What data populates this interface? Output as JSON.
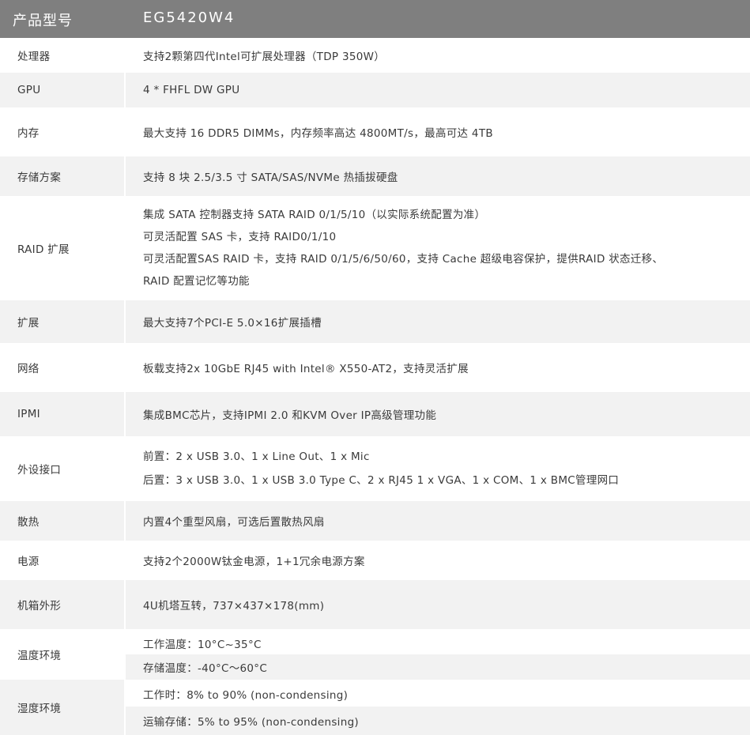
{
  "header": {
    "label": "产品型号",
    "value": "EG5420W4"
  },
  "rows": [
    {
      "label": "处理器",
      "lines": [
        "支持2颗第四代Intel可扩展处理器（TDP 350W）"
      ]
    },
    {
      "label": "GPU",
      "lines": [
        "4 * FHFL DW GPU"
      ]
    },
    {
      "label": "内存",
      "lines": [
        "最大支持 16 DDR5 DIMMs，内存频率高达 4800MT/s，最高可达 4TB"
      ]
    },
    {
      "label": "存储方案",
      "lines": [
        "支持 8 块 2.5/3.5 寸 SATA/SAS/NVMe 热插拔硬盘"
      ]
    },
    {
      "label": "RAID 扩展",
      "lines": [
        "集成 SATA 控制器支持 SATA RAID 0/1/5/10（以实际系统配置为准）",
        "可灵活配置 SAS 卡，支持 RAID0/1/10",
        "可灵活配置SAS RAID 卡，支持 RAID 0/1/5/6/50/60，支持 Cache 超级电容保护，提供RAID 状态迁移、",
        "RAID 配置记忆等功能"
      ]
    },
    {
      "label": "扩展",
      "lines": [
        "最大支持7个PCI-E 5.0×16扩展插槽"
      ]
    },
    {
      "label": "网络",
      "lines": [
        "板载支持2x 10GbE RJ45 with Intel® X550-AT2，支持灵活扩展"
      ]
    },
    {
      "label": "IPMI",
      "lines": [
        "集成BMC芯片，支持IPMI 2.0 和KVM Over IP高级管理功能"
      ]
    },
    {
      "label": "外设接口",
      "lines": [
        "前置：2 x USB 3.0、1 x Line Out、1 x Mic",
        "后置：3 x USB 3.0、1 x USB 3.0 Type C、2 x RJ45 1 x VGA、1 x COM、1 x BMC管理网口"
      ]
    },
    {
      "label": "散热",
      "lines": [
        "内置4个重型风扇，可选后置散热风扇"
      ]
    },
    {
      "label": "电源",
      "lines": [
        "支持2个2000W钛金电源，1+1冗余电源方案"
      ]
    },
    {
      "label": "机箱外形",
      "lines": [
        "4U机塔互转，737×437×178(mm)"
      ]
    },
    {
      "label": "温度环境",
      "lines": [
        "工作温度：10°C~35°C",
        "存储温度：-40°C～60°C"
      ]
    },
    {
      "label": "湿度环境",
      "lines": [
        "工作时：8% to 90% (non-condensing)",
        "运输存储：5% to 95% (non-condensing)"
      ]
    }
  ]
}
